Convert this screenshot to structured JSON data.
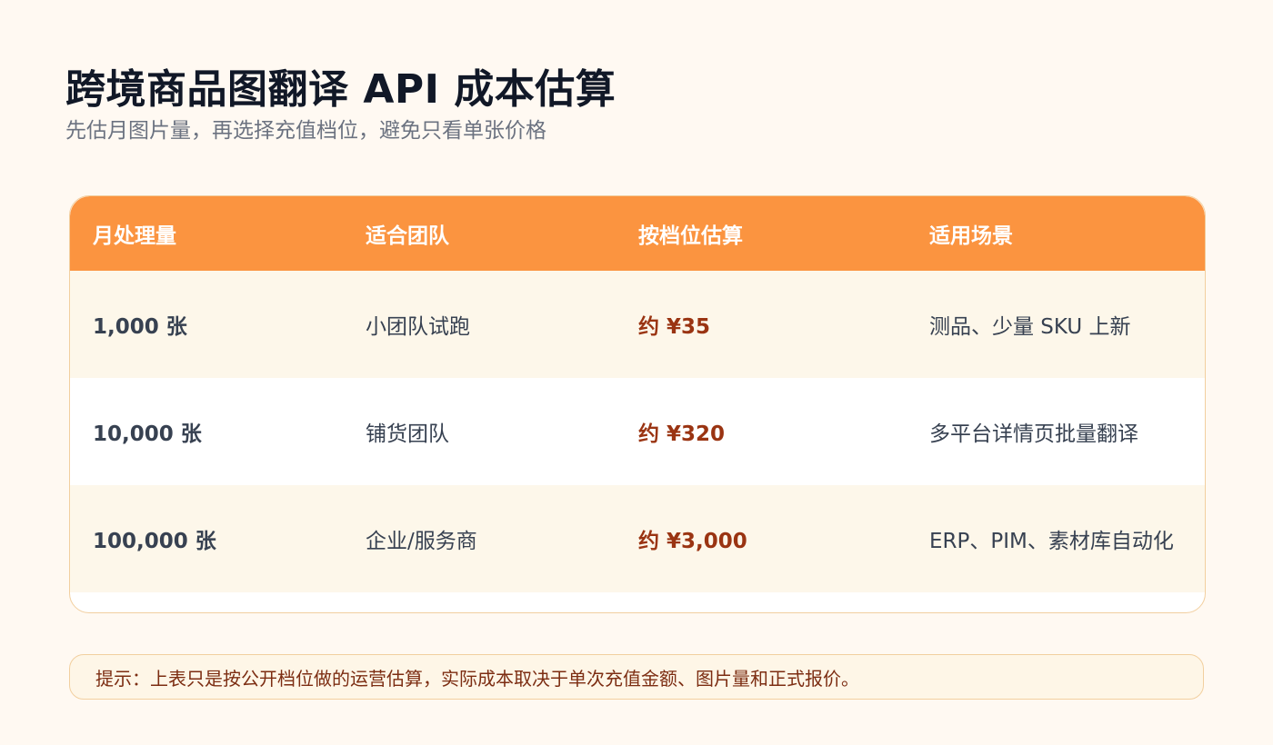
{
  "page": {
    "title": "跨境商品图翻译 API 成本估算",
    "subtitle": "先估月图片量，再选择充值档位，避免只看单张价格"
  },
  "table": {
    "headers": [
      "月处理量",
      "适合团队",
      "按档位估算",
      "适用场景"
    ],
    "rows": [
      {
        "volume": "1,000 张",
        "team": "小团队试跑",
        "price": "约 ¥35",
        "scenario": "测品、少量 SKU 上新"
      },
      {
        "volume": "10,000 张",
        "team": "铺货团队",
        "price": "约 ¥320",
        "scenario": "多平台详情页批量翻译"
      },
      {
        "volume": "100,000 张",
        "team": "企业/服务商",
        "price": "约 ¥3,000",
        "scenario": "ERP、PIM、素材库自动化"
      }
    ]
  },
  "tip": {
    "text": "提示：上表只是按公开档位做的运营估算，实际成本取决于单次充值金额、图片量和正式报价。"
  },
  "colors": {
    "header_bg": "#fb9440",
    "price_text": "#9a3412",
    "page_bg": "#fff9f2",
    "row_warm": "#fdf7ea"
  }
}
